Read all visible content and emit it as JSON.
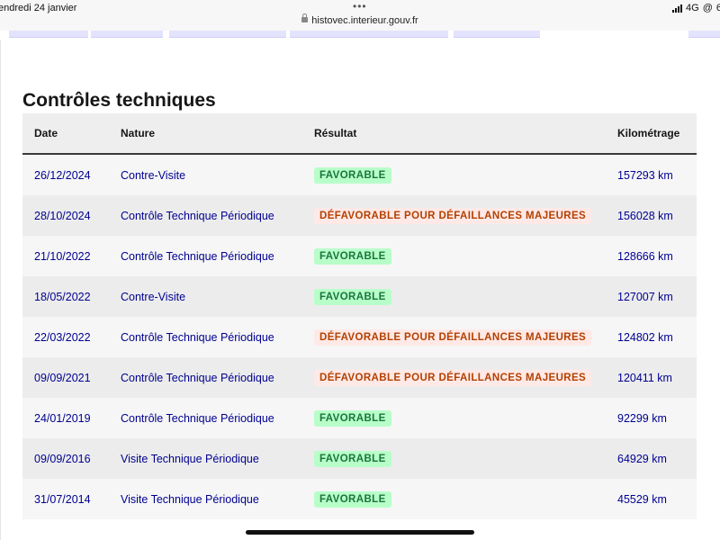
{
  "status_bar": {
    "date": "endredi 24 janvier",
    "url": "histovec.interieur.gouv.fr",
    "network": "4G",
    "battery_partial": "6",
    "dots": "•••"
  },
  "section": {
    "title": "Contrôles techniques"
  },
  "table": {
    "headers": [
      "Date",
      "Nature",
      "Résultat",
      "Kilométrage"
    ],
    "rows": [
      {
        "date": "26/12/2024",
        "nature": "Contre-Visite",
        "result": "FAVORABLE",
        "status": "favorable",
        "km": "157293 km"
      },
      {
        "date": "28/10/2024",
        "nature": "Contrôle Technique Périodique",
        "result": "DÉFAVORABLE POUR DÉFAILLANCES MAJEURES",
        "status": "defavorable",
        "km": "156028 km"
      },
      {
        "date": "21/10/2022",
        "nature": "Contrôle Technique Périodique",
        "result": "FAVORABLE",
        "status": "favorable",
        "km": "128666 km"
      },
      {
        "date": "18/05/2022",
        "nature": "Contre-Visite",
        "result": "FAVORABLE",
        "status": "favorable",
        "km": "127007 km"
      },
      {
        "date": "22/03/2022",
        "nature": "Contrôle Technique Périodique",
        "result": "DÉFAVORABLE POUR DÉFAILLANCES MAJEURES",
        "status": "defavorable",
        "km": "124802 km"
      },
      {
        "date": "09/09/2021",
        "nature": "Contrôle Technique Périodique",
        "result": "DÉFAVORABLE POUR DÉFAILLANCES MAJEURES",
        "status": "defavorable",
        "km": "120411 km"
      },
      {
        "date": "24/01/2019",
        "nature": "Contrôle Technique Périodique",
        "result": "FAVORABLE",
        "status": "favorable",
        "km": "92299 km"
      },
      {
        "date": "09/09/2016",
        "nature": "Visite Technique Périodique",
        "result": "FAVORABLE",
        "status": "favorable",
        "km": "64929 km"
      },
      {
        "date": "31/07/2014",
        "nature": "Visite Technique Périodique",
        "result": "FAVORABLE",
        "status": "favorable",
        "km": "45529 km"
      }
    ]
  },
  "colors": {
    "link_blue": "#000091",
    "favorable_bg": "#b8fec9",
    "favorable_text": "#18753c",
    "defavorable_bg": "#ffe9e6",
    "defavorable_text": "#b34000"
  }
}
